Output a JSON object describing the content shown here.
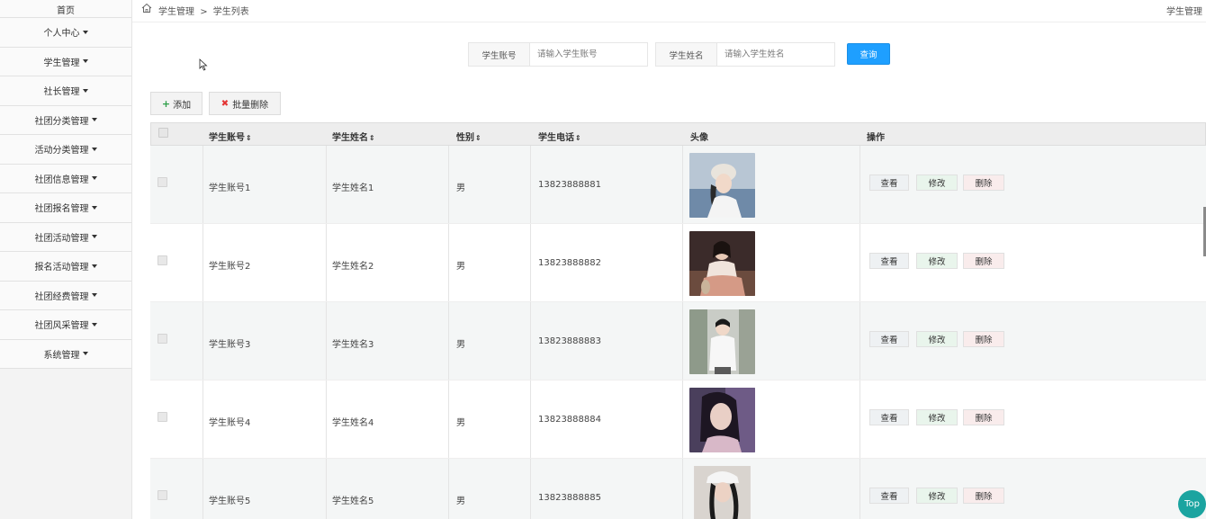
{
  "sidebar": {
    "items": [
      {
        "label": "首页",
        "caret": false
      },
      {
        "label": "个人中心",
        "caret": true
      },
      {
        "label": "学生管理",
        "caret": true
      },
      {
        "label": "社长管理",
        "caret": true
      },
      {
        "label": "社团分类管理",
        "caret": true
      },
      {
        "label": "活动分类管理",
        "caret": true
      },
      {
        "label": "社团信息管理",
        "caret": true
      },
      {
        "label": "社团报名管理",
        "caret": true
      },
      {
        "label": "社团活动管理",
        "caret": true
      },
      {
        "label": "报名活动管理",
        "caret": true
      },
      {
        "label": "社团经费管理",
        "caret": true
      },
      {
        "label": "社团风采管理",
        "caret": true
      },
      {
        "label": "系统管理",
        "caret": true
      }
    ]
  },
  "breadcrumb": {
    "parent": "学生管理",
    "separator": ">",
    "current": "学生列表"
  },
  "header": {
    "right_title": "学生管理"
  },
  "search": {
    "account_label": "学生账号",
    "account_placeholder": "请输入学生账号",
    "name_label": "学生姓名",
    "name_placeholder": "请输入学生姓名",
    "query_label": "查询"
  },
  "actions": {
    "add_label": "添加",
    "batch_delete_label": "批量删除"
  },
  "table": {
    "columns": {
      "account": "学生账号",
      "name": "学生姓名",
      "gender": "性别",
      "phone": "学生电话",
      "avatar": "头像",
      "ops": "操作"
    },
    "sort_glyph": "⇕",
    "rows": [
      {
        "account": "学生账号1",
        "name": "学生姓名1",
        "gender": "男",
        "phone": "13823888881"
      },
      {
        "account": "学生账号2",
        "name": "学生姓名2",
        "gender": "男",
        "phone": "13823888882"
      },
      {
        "account": "学生账号3",
        "name": "学生姓名3",
        "gender": "男",
        "phone": "13823888883"
      },
      {
        "account": "学生账号4",
        "name": "学生姓名4",
        "gender": "男",
        "phone": "13823888884"
      },
      {
        "account": "学生账号5",
        "name": "学生姓名5",
        "gender": "男",
        "phone": "13823888885"
      }
    ],
    "op_view": "查看",
    "op_edit": "修改",
    "op_delete": "删除"
  },
  "top_button": "Top",
  "colors": {
    "primary": "#1e9fff",
    "top_button": "#1ba4a0"
  }
}
